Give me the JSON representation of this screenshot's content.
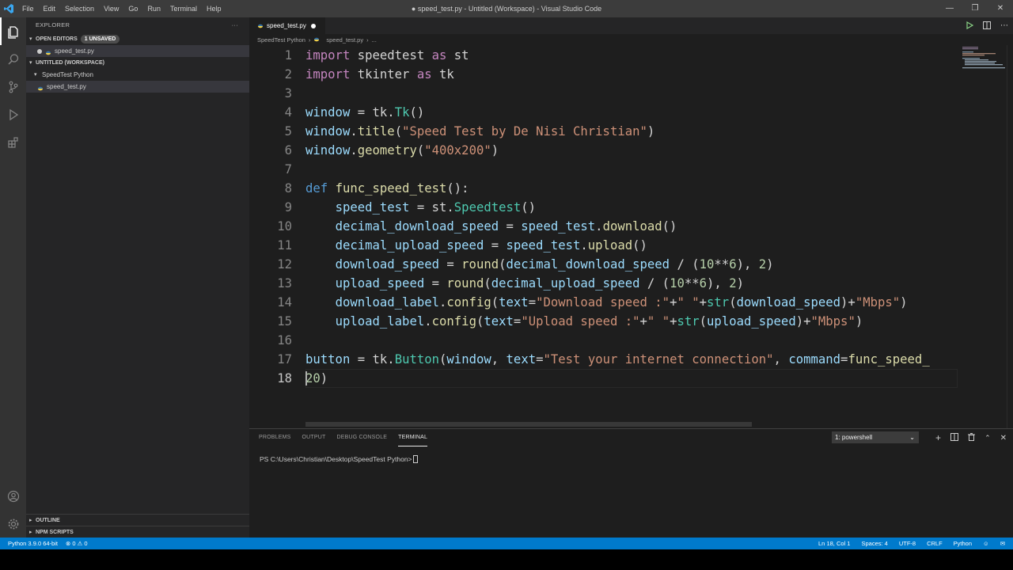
{
  "window": {
    "title": "● speed_test.py - Untitled (Workspace) - Visual Studio Code",
    "menu": [
      "File",
      "Edit",
      "Selection",
      "View",
      "Go",
      "Run",
      "Terminal",
      "Help"
    ]
  },
  "sidebar": {
    "title": "EXPLORER",
    "more": "···",
    "open_editors": {
      "label": "OPEN EDITORS",
      "badge": "1 UNSAVED",
      "file": "speed_test.py"
    },
    "workspace": {
      "label": "UNTITLED (WORKSPACE)",
      "folder": "SpeedTest Python",
      "file": "speed_test.py"
    },
    "outline": "OUTLINE",
    "npm": "NPM SCRIPTS"
  },
  "tab": {
    "label": "speed_test.py"
  },
  "breadcrumb": {
    "folder": "SpeedTest Python",
    "file": "speed_test.py",
    "more": "..."
  },
  "code": {
    "line_numbers": [
      "1",
      "2",
      "3",
      "4",
      "5",
      "6",
      "7",
      "8",
      "9",
      "10",
      "11",
      "12",
      "13",
      "14",
      "15",
      "16",
      "17",
      "18"
    ],
    "lines": [
      [
        [
          "kw",
          "import"
        ],
        [
          "txt",
          " speedtest "
        ],
        [
          "kw",
          "as"
        ],
        [
          "txt",
          " st"
        ]
      ],
      [
        [
          "kw",
          "import"
        ],
        [
          "txt",
          " tkinter "
        ],
        [
          "kw",
          "as"
        ],
        [
          "txt",
          " tk"
        ]
      ],
      [],
      [
        [
          "var",
          "window"
        ],
        [
          "txt",
          " = tk."
        ],
        [
          "cls",
          "Tk"
        ],
        [
          "txt",
          "()"
        ]
      ],
      [
        [
          "var",
          "window"
        ],
        [
          "txt",
          "."
        ],
        [
          "fn",
          "title"
        ],
        [
          "txt",
          "("
        ],
        [
          "str",
          "\"Speed Test by De Nisi Christian\""
        ],
        [
          "txt",
          ")"
        ]
      ],
      [
        [
          "var",
          "window"
        ],
        [
          "txt",
          "."
        ],
        [
          "fn",
          "geometry"
        ],
        [
          "txt",
          "("
        ],
        [
          "str",
          "\"400x200\""
        ],
        [
          "txt",
          ")"
        ]
      ],
      [],
      [
        [
          "kd",
          "def"
        ],
        [
          "txt",
          " "
        ],
        [
          "fn",
          "func_speed_test"
        ],
        [
          "txt",
          "():"
        ]
      ],
      [
        [
          "txt",
          "    "
        ],
        [
          "var",
          "speed_test"
        ],
        [
          "txt",
          " = st."
        ],
        [
          "cls",
          "Speedtest"
        ],
        [
          "txt",
          "()"
        ]
      ],
      [
        [
          "txt",
          "    "
        ],
        [
          "var",
          "decimal_download_speed"
        ],
        [
          "txt",
          " = "
        ],
        [
          "var",
          "speed_test"
        ],
        [
          "txt",
          "."
        ],
        [
          "fn",
          "download"
        ],
        [
          "txt",
          "()"
        ]
      ],
      [
        [
          "txt",
          "    "
        ],
        [
          "var",
          "decimal_upload_speed"
        ],
        [
          "txt",
          " = "
        ],
        [
          "var",
          "speed_test"
        ],
        [
          "txt",
          "."
        ],
        [
          "fn",
          "upload"
        ],
        [
          "txt",
          "()"
        ]
      ],
      [
        [
          "txt",
          "    "
        ],
        [
          "var",
          "download_speed"
        ],
        [
          "txt",
          " = "
        ],
        [
          "fn",
          "round"
        ],
        [
          "txt",
          "("
        ],
        [
          "var",
          "decimal_download_speed"
        ],
        [
          "txt",
          " / ("
        ],
        [
          "num",
          "10"
        ],
        [
          "txt",
          "**"
        ],
        [
          "num",
          "6"
        ],
        [
          "txt",
          "), "
        ],
        [
          "num",
          "2"
        ],
        [
          "txt",
          ")"
        ]
      ],
      [
        [
          "txt",
          "    "
        ],
        [
          "var",
          "upload_speed"
        ],
        [
          "txt",
          " = "
        ],
        [
          "fn",
          "round"
        ],
        [
          "txt",
          "("
        ],
        [
          "var",
          "decimal_upload_speed"
        ],
        [
          "txt",
          " / ("
        ],
        [
          "num",
          "10"
        ],
        [
          "txt",
          "**"
        ],
        [
          "num",
          "6"
        ],
        [
          "txt",
          "), "
        ],
        [
          "num",
          "2"
        ],
        [
          "txt",
          ")"
        ]
      ],
      [
        [
          "txt",
          "    "
        ],
        [
          "var",
          "download_label"
        ],
        [
          "txt",
          "."
        ],
        [
          "fn",
          "config"
        ],
        [
          "txt",
          "("
        ],
        [
          "var",
          "text"
        ],
        [
          "txt",
          "="
        ],
        [
          "str",
          "\"Download speed :\""
        ],
        [
          "txt",
          "+"
        ],
        [
          "str",
          "\" \""
        ],
        [
          "txt",
          "+"
        ],
        [
          "cls",
          "str"
        ],
        [
          "txt",
          "("
        ],
        [
          "var",
          "download_speed"
        ],
        [
          "txt",
          ")+"
        ],
        [
          "str",
          "\"Mbps\""
        ],
        [
          "txt",
          ")"
        ]
      ],
      [
        [
          "txt",
          "    "
        ],
        [
          "var",
          "upload_label"
        ],
        [
          "txt",
          "."
        ],
        [
          "fn",
          "config"
        ],
        [
          "txt",
          "("
        ],
        [
          "var",
          "text"
        ],
        [
          "txt",
          "="
        ],
        [
          "str",
          "\"Upload speed :\""
        ],
        [
          "txt",
          "+"
        ],
        [
          "str",
          "\" \""
        ],
        [
          "txt",
          "+"
        ],
        [
          "cls",
          "str"
        ],
        [
          "txt",
          "("
        ],
        [
          "var",
          "upload_speed"
        ],
        [
          "txt",
          ")+"
        ],
        [
          "str",
          "\"Mbps\""
        ],
        [
          "txt",
          ")"
        ]
      ],
      [],
      [
        [
          "var",
          "button"
        ],
        [
          "txt",
          " = tk."
        ],
        [
          "cls",
          "Button"
        ],
        [
          "txt",
          "("
        ],
        [
          "var",
          "window"
        ],
        [
          "txt",
          ", "
        ],
        [
          "var",
          "text"
        ],
        [
          "txt",
          "="
        ],
        [
          "str",
          "\"Test your internet connection\""
        ],
        [
          "txt",
          ", "
        ],
        [
          "var",
          "command"
        ],
        [
          "txt",
          "="
        ],
        [
          "fn",
          "func_speed_"
        ]
      ],
      [
        [
          "num",
          "20"
        ],
        [
          "txt",
          ")"
        ]
      ]
    ]
  },
  "panel": {
    "tabs": [
      "PROBLEMS",
      "OUTPUT",
      "DEBUG CONSOLE",
      "TERMINAL"
    ],
    "active_tab": "TERMINAL",
    "terminal_select": "1: powershell",
    "prompt": "PS C:\\Users\\Christian\\Desktop\\SpeedTest Python>"
  },
  "statusbar": {
    "interpreter": "Python 3.9.0 64-bit",
    "problems": "⊗ 0 ⚠ 0",
    "position": "Ln 18, Col 1",
    "spaces": "Spaces: 4",
    "encoding": "UTF-8",
    "eol": "CRLF",
    "language": "Python"
  },
  "colors": {
    "accent": "#007acc",
    "keyword": "#c586c0",
    "string": "#ce9178",
    "function": "#dcdcaa",
    "variable": "#9cdcfe"
  }
}
